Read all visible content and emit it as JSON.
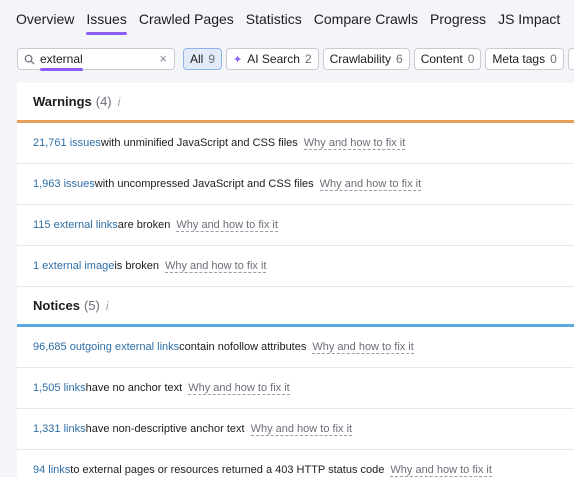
{
  "nav": {
    "tabs": [
      {
        "label": "Overview"
      },
      {
        "label": "Issues"
      },
      {
        "label": "Crawled Pages"
      },
      {
        "label": "Statistics"
      },
      {
        "label": "Compare Crawls"
      },
      {
        "label": "Progress"
      },
      {
        "label": "JS Impact"
      }
    ],
    "active": "Issues"
  },
  "search": {
    "value": "external",
    "clear_icon": "×"
  },
  "filters": [
    {
      "label": "All",
      "count": "9",
      "active": true
    },
    {
      "label": "AI Search",
      "count": "2"
    },
    {
      "label": "Crawlability",
      "count": "6"
    },
    {
      "label": "Content",
      "count": "0"
    },
    {
      "label": "Meta tags",
      "count": "0"
    }
  ],
  "more_label": "•••",
  "colors": {
    "accent": "#8b5cf6",
    "link": "#2e6ea5",
    "warning": "#e7a05a",
    "notice": "#5aa8df"
  },
  "warnings": {
    "title": "Warnings",
    "count": "(4)",
    "info": "i",
    "rows": [
      {
        "issue": "21,761 issues",
        "text": " with unminified JavaScript and CSS files",
        "fix": "Why and how to fix it"
      },
      {
        "issue": "1,963 issues",
        "text": " with uncompressed JavaScript and CSS files",
        "fix": "Why and how to fix it"
      },
      {
        "issue": "115 external links",
        "text": " are broken",
        "fix": "Why and how to fix it"
      },
      {
        "issue": "1 external image",
        "text": " is broken",
        "fix": "Why and how to fix it"
      }
    ]
  },
  "notices": {
    "title": "Notices",
    "count": "(5)",
    "info": "i",
    "rows": [
      {
        "issue": "96,685 outgoing external links",
        "text": " contain nofollow attributes",
        "fix": "Why and how to fix it"
      },
      {
        "issue": "1,505 links",
        "text": " have no anchor text",
        "fix": "Why and how to fix it"
      },
      {
        "issue": "1,331 links",
        "text": " have non-descriptive anchor text",
        "fix": "Why and how to fix it"
      },
      {
        "issue": "94 links",
        "text": " to external pages or resources returned a 403 HTTP status code",
        "fix": "Why and how to fix it"
      }
    ]
  }
}
